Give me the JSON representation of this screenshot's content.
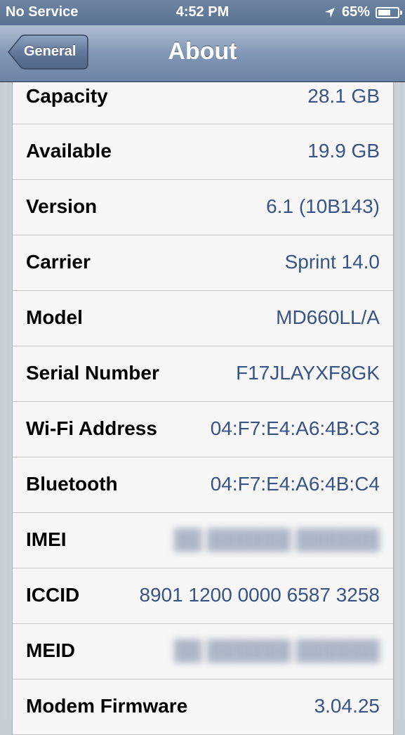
{
  "status": {
    "carrier": "No Service",
    "time": "4:52 PM",
    "battery": "65%",
    "battery_level": 0.65
  },
  "nav": {
    "title": "About",
    "back_label": "General"
  },
  "rows": [
    {
      "label": "Capacity",
      "value": "28.1 GB"
    },
    {
      "label": "Available",
      "value": "19.9 GB"
    },
    {
      "label": "Version",
      "value": "6.1 (10B143)"
    },
    {
      "label": "Carrier",
      "value": "Sprint 14.0"
    },
    {
      "label": "Model",
      "value": "MD660LL/A"
    },
    {
      "label": "Serial Number",
      "value": "F17JLAYXF8GK"
    },
    {
      "label": "Wi-Fi Address",
      "value": "04:F7:E4:A6:4B:C3"
    },
    {
      "label": "Bluetooth",
      "value": "04:F7:E4:A6:4B:C4"
    },
    {
      "label": "IMEI",
      "value": ""
    },
    {
      "label": "ICCID",
      "value": "8901 1200 0000 6587 3258"
    },
    {
      "label": "MEID",
      "value": ""
    },
    {
      "label": "Modem Firmware",
      "value": "3.04.25"
    }
  ],
  "colors": {
    "value_text": "#385487",
    "nav_bar": "#6b83a5"
  }
}
